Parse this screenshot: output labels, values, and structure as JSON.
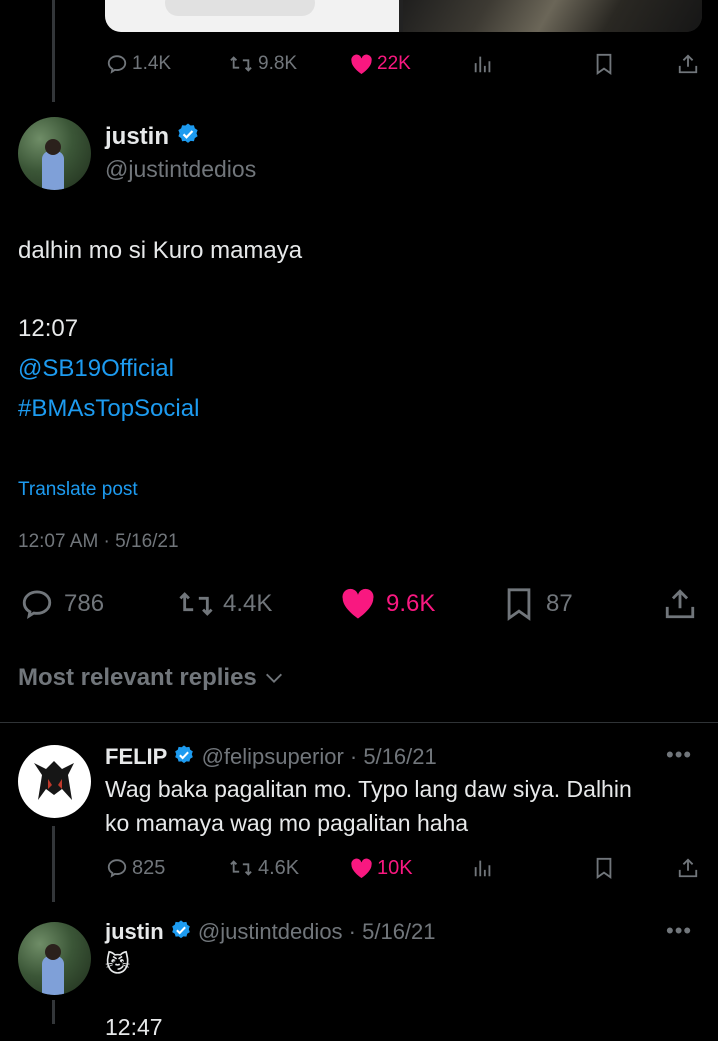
{
  "prev_post": {
    "stats": {
      "replies": "1.4K",
      "reposts": "9.8K",
      "likes": "22K"
    }
  },
  "main_post": {
    "author_name": "justin",
    "author_handle": "@justintdedios",
    "text_line1": "dalhin mo si Kuro mamaya",
    "text_time": "12:07",
    "mention": "@SB19Official",
    "hashtag": "#BMAsTopSocial",
    "translate": "Translate post",
    "timestamp": "12:07 AM · 5/16/21",
    "stats": {
      "replies": "786",
      "reposts": "4.4K",
      "likes": "9.6K",
      "bookmarks": "87"
    }
  },
  "replies_header": "Most relevant replies",
  "reply1": {
    "author_name": "FELIP",
    "author_handle": "@felipsuperior · 5/16/21",
    "text_line1": "Wag baka pagalitan mo. Typo lang daw siya. Dalhin",
    "text_line2": "ko mamaya wag mo pagalitan haha",
    "stats": {
      "replies": "825",
      "reposts": "4.6K",
      "likes": "10K"
    }
  },
  "reply2": {
    "author_name": "justin",
    "author_handle": "@justintdedios · 5/16/21",
    "emoji": "😼",
    "partial_text": "12:47"
  },
  "colors": {
    "like": "#f91880",
    "link": "#1d9bf0",
    "muted": "#71767b",
    "verified": "#1d9bf0"
  }
}
